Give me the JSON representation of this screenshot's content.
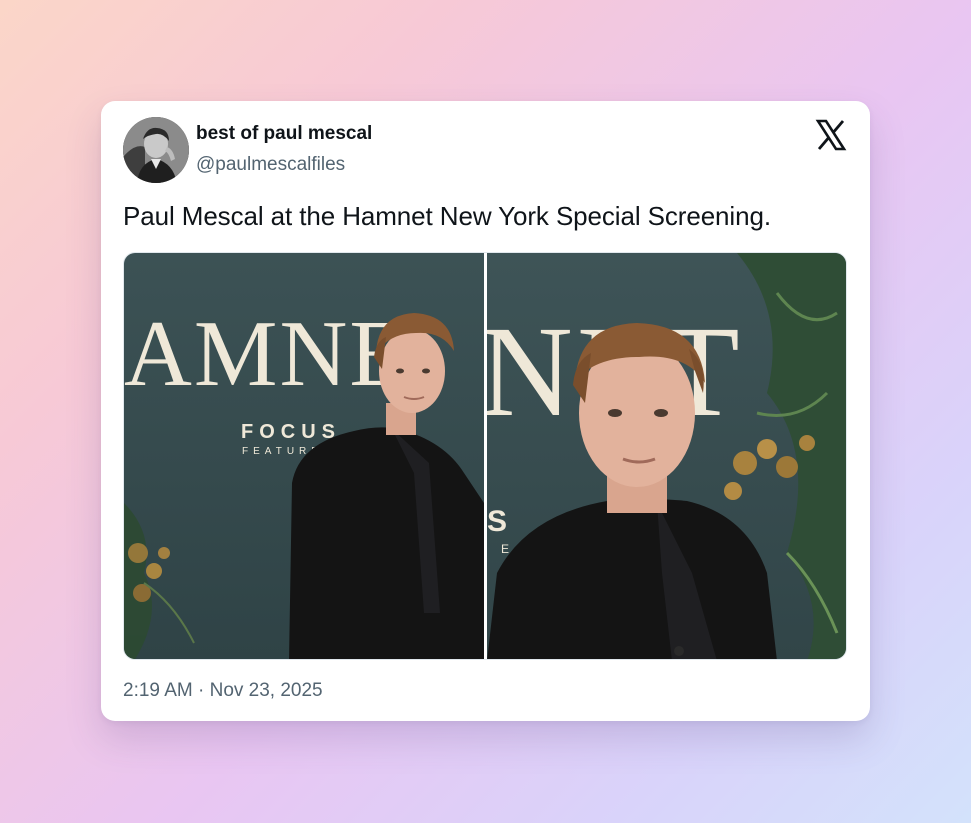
{
  "tweet": {
    "author": {
      "display_name": "best of paul mescal",
      "handle": "@paulmescalfiles",
      "avatar_icon": "profile-photo"
    },
    "platform_icon": "x-logo-icon",
    "text": "Paul Mescal at the Hamnet New York Special Screening.",
    "media": [
      {
        "kind": "photo",
        "backdrop_text": "AMNE",
        "logo_line1": "FOCUS",
        "logo_line2": "FEATURES"
      },
      {
        "kind": "photo",
        "backdrop_text": "NET",
        "logo_line1": "S",
        "logo_line2": "E"
      }
    ],
    "timestamp": "2:19 AM · Nov 23, 2025"
  },
  "colors": {
    "text_primary": "#0f1419",
    "text_secondary": "#536471",
    "card_bg": "#ffffff",
    "backdrop_teal": "#3f5558",
    "backdrop_letters": "#efe8d8"
  }
}
